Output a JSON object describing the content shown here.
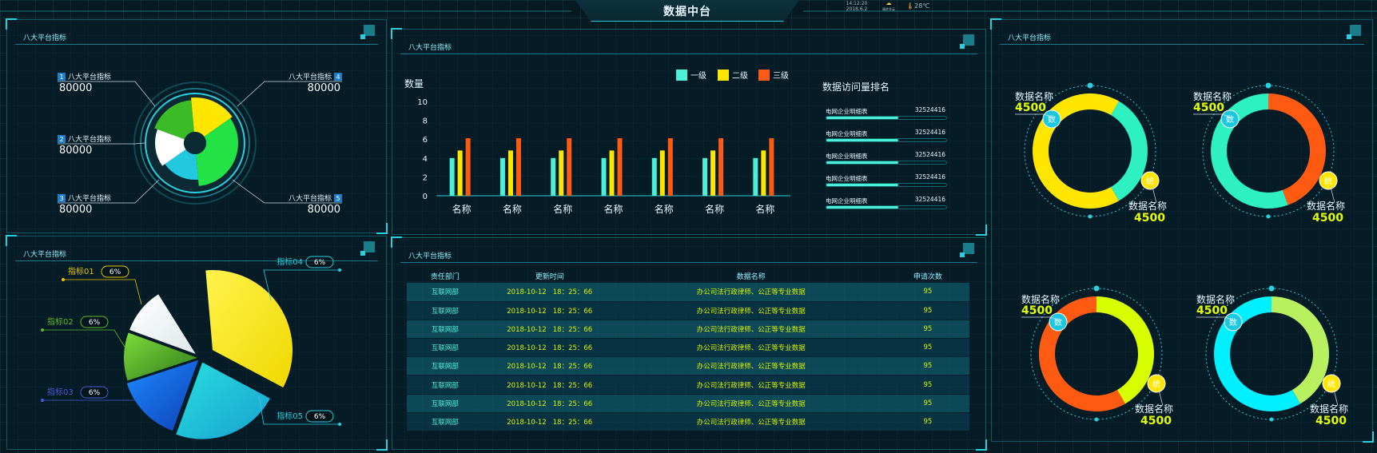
{
  "header": {
    "title": "数据中台",
    "time": "14:12:20",
    "date": "2018.6.2",
    "weather_label": "晴转多云",
    "temperature": "28℃"
  },
  "colors": {
    "accent": "#2ad0e0",
    "level1": "#4cf0d8",
    "level2": "#ffe600",
    "level3": "#ff5a12",
    "yellow_value": "#e6ff00"
  },
  "panels": {
    "donut_indicators": {
      "title": "八大平台指标",
      "items": [
        {
          "num": "1",
          "label": "八大平台指标",
          "value": "80000"
        },
        {
          "num": "2",
          "label": "八大平台指标",
          "value": "80000"
        },
        {
          "num": "3",
          "label": "八大平台指标",
          "value": "80000"
        },
        {
          "num": "4",
          "label": "八大平台指标",
          "value": "80000"
        },
        {
          "num": "5",
          "label": "八大平台指标",
          "value": "80000"
        }
      ]
    },
    "pie_indicators": {
      "title": "八大平台指标",
      "items": [
        {
          "label": "指标01",
          "pct": "6%"
        },
        {
          "label": "指标02",
          "pct": "6%"
        },
        {
          "label": "指标03",
          "pct": "6%"
        },
        {
          "label": "指标04",
          "pct": "6%"
        },
        {
          "label": "指标05",
          "pct": "6%"
        }
      ]
    },
    "bar_chart": {
      "title": "八大平台指标",
      "legend": [
        "一级",
        "二级",
        "三级"
      ]
    },
    "ranking": {
      "title": "数据访问量排名",
      "items": [
        {
          "name": "电网企业明细表",
          "value": "32524416",
          "ratio": 0.6
        },
        {
          "name": "电网企业明细表",
          "value": "32524416",
          "ratio": 0.6
        },
        {
          "name": "电网企业明细表",
          "value": "32524416",
          "ratio": 0.6
        },
        {
          "name": "电网企业明细表",
          "value": "32524416",
          "ratio": 0.6
        },
        {
          "name": "电网企业明细表",
          "value": "32524416",
          "ratio": 0.6
        }
      ]
    },
    "table": {
      "title": "八大平台指标",
      "columns": [
        "责任部门",
        "更新时间",
        "数据名称",
        "申请次数"
      ],
      "rows": [
        [
          "互联网部",
          "2018-10-12   18：25：66",
          "办公司法行政律师、公正等专业数据",
          "95"
        ],
        [
          "互联网部",
          "2018-10-12   18：25：66",
          "办公司法行政律师、公正等专业数据",
          "95"
        ],
        [
          "互联网部",
          "2018-10-12   18：25：66",
          "办公司法行政律师、公正等专业数据",
          "95"
        ],
        [
          "互联网部",
          "2018-10-12   18：25：66",
          "办公司法行政律师、公正等专业数据",
          "95"
        ],
        [
          "互联网部",
          "2018-10-12   18：25：66",
          "办公司法行政律师、公正等专业数据",
          "95"
        ],
        [
          "互联网部",
          "2018-10-12   18：25：66",
          "办公司法行政律师、公正等专业数据",
          "95"
        ],
        [
          "互联网部",
          "2018-10-12   18：25：66",
          "办公司法行政律师、公正等专业数据",
          "95"
        ],
        [
          "互联网部",
          "2018-10-12   18：25：66",
          "办公司法行政律师、公正等专业数据",
          "95"
        ]
      ]
    },
    "rings": {
      "title": "八大平台指标",
      "badge_a": "数",
      "badge_b": "统",
      "items": [
        {
          "label_top": "数据名称",
          "value_top": "4500",
          "label_bottom": "数据名称",
          "value_bottom": "4500"
        },
        {
          "label_top": "数据名称",
          "value_top": "4500",
          "label_bottom": "数据名称",
          "value_bottom": "4500"
        },
        {
          "label_top": "数据名称",
          "value_top": "4500",
          "label_bottom": "数据名称",
          "value_bottom": "4500"
        },
        {
          "label_top": "数据名称",
          "value_top": "4500",
          "label_bottom": "数据名称",
          "value_bottom": "4500"
        }
      ]
    }
  },
  "chart_data": [
    {
      "type": "bar",
      "title": "",
      "ylabel": "数量",
      "xlabel": "",
      "ylim": [
        0,
        10
      ],
      "yticks": [
        "0",
        "2",
        "4",
        "6",
        "8",
        "10"
      ],
      "categories": [
        "名称",
        "名称",
        "名称",
        "名称",
        "名称",
        "名称",
        "名称"
      ],
      "series": [
        {
          "name": "一级",
          "values": [
            4,
            4,
            4,
            4,
            4,
            4,
            4
          ]
        },
        {
          "name": "二级",
          "values": [
            4.8,
            4.8,
            4.8,
            4.8,
            4.8,
            4.8,
            4.8
          ]
        },
        {
          "name": "三级",
          "values": [
            6.1,
            6.1,
            6.1,
            6.1,
            6.1,
            6.1,
            6.1
          ]
        }
      ],
      "legend": "top-right",
      "grid": false
    }
  ]
}
